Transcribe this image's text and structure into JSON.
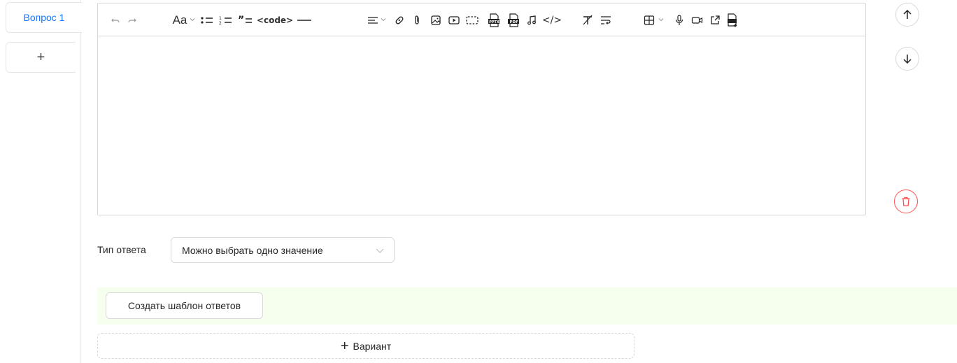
{
  "tabs": {
    "active_label": "Вопрос 1",
    "add_symbol": "+"
  },
  "toolbar": {
    "format_label": "Aa",
    "code_label": "<code>",
    "codeblock_label": "</>",
    "icons": [
      "undo-icon",
      "redo-icon",
      "font-format-icon",
      "bullet-list-icon",
      "ordered-list-icon",
      "quote-icon",
      "inline-code-icon",
      "horizontal-rule-icon",
      "align-icon",
      "link-icon",
      "attachment-icon",
      "image-icon",
      "video-icon",
      "frame-icon",
      "pptx-icon",
      "pdf-icon",
      "audio-icon",
      "code-block-icon",
      "clear-format-icon",
      "wrap-icon",
      "table-icon",
      "microphone-icon",
      "camera-icon",
      "external-link-icon",
      "document-export-icon"
    ]
  },
  "answer_type": {
    "label": "Тип ответа",
    "value": "Можно выбрать одно значение"
  },
  "template_button": "Создать шаблон ответов",
  "add_variant": {
    "symbol": "+",
    "label": "Вариант"
  },
  "colors": {
    "accent": "#1677ff",
    "danger": "#ff4d4f",
    "band": "#f6ffed",
    "border": "#d9d9d9"
  }
}
